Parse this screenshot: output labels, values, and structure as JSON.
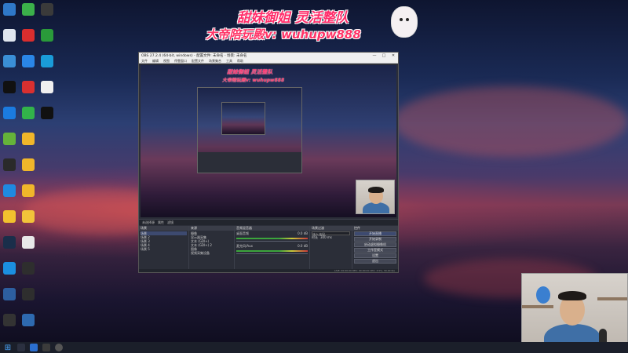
{
  "banner": {
    "line1": "甜妹御姐 灵活整队",
    "line2": "大帝陪玩殿v: wuhupw888"
  },
  "obs": {
    "title": "OBS 27.2.4 (64-bit, windows) - 配置文件: 未命名 - 场景: 未命名",
    "menu": [
      "文件",
      "编辑",
      "视图",
      "停靠窗口",
      "配置文件",
      "场景集合",
      "工具",
      "帮助"
    ],
    "window_controls": [
      "—",
      "□",
      "✕"
    ],
    "preview_banner_l1": "甜妹御姐 灵活整队",
    "preview_banner_l2": "大帝陪玩殿v: wuhupw888",
    "toolbar_text": "未选择源",
    "toolbar_props": "属性",
    "toolbar_filters": "滤镜",
    "docks": {
      "scenes": {
        "title": "场景",
        "items": [
          "场景",
          "场景 2",
          "场景 3",
          "场景 4",
          "场景 5"
        ]
      },
      "sources": {
        "title": "来源",
        "items": [
          "摄像",
          "显示器采集",
          "文本 (GDI+)",
          "文本 (GDI+) 2",
          "图像",
          "视频采集设备"
        ]
      },
      "mixer": {
        "title": "音频混音器",
        "ch1": "桌面音频",
        "ch1_db": "0.0 dB",
        "ch2": "麦克风/Aux",
        "ch2_db": "0.0 dB"
      },
      "transitions": {
        "title": "场景过渡",
        "type": "淡入淡出",
        "duration_label": "时长",
        "duration": "300 ms"
      },
      "controls": {
        "title": "控件",
        "buttons": [
          "开始直播",
          "开始录制",
          "启动虚拟摄像机",
          "工作室模式",
          "设置",
          "退出"
        ]
      }
    },
    "status": "LIVE: 00:00:00   REC: 00:00:00   CPU: 3.5%, 30.00 fps"
  },
  "colors": {
    "banner_pink": "#ff2d6a",
    "obs_bg": "#2b2e38",
    "obs_active": "#3d4a70"
  }
}
